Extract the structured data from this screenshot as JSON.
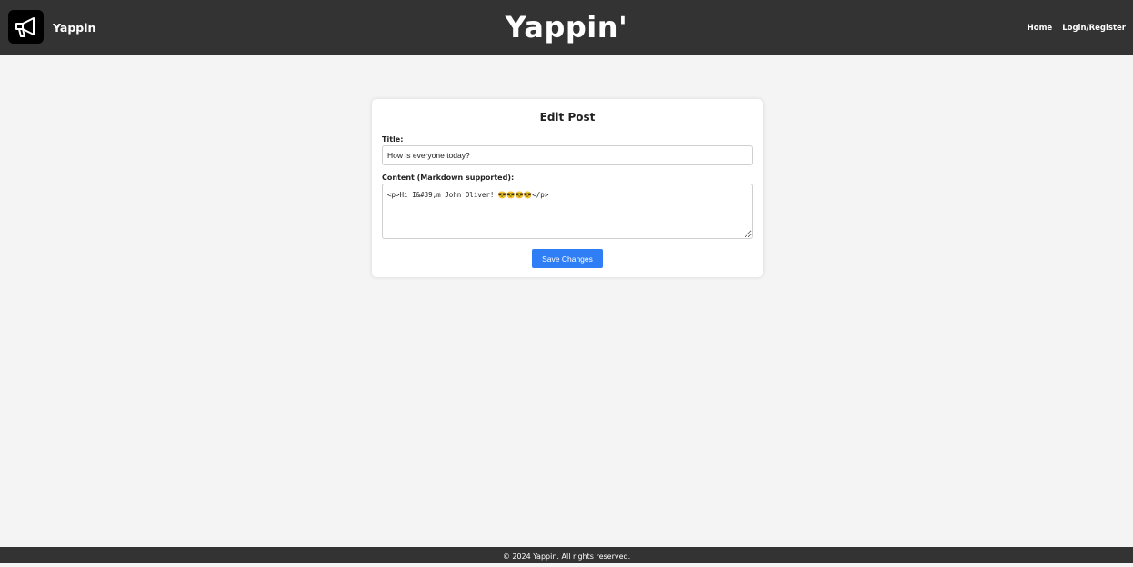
{
  "header": {
    "brand_name": "Yappin",
    "logo_icon": "megaphone-icon",
    "site_title": "Yappin'",
    "nav": {
      "home_label": "Home",
      "login_label": "Login/Register"
    }
  },
  "form": {
    "heading": "Edit Post",
    "title_label": "Title:",
    "title_value": "How is everyone today?",
    "content_label": "Content (Markdown supported):",
    "content_value": "<p>Hi I&#39;m John Oliver! 😎😎😎😎</p>",
    "submit_label": "Save Changes"
  },
  "footer": {
    "copyright": "© 2024 Yappin. All rights reserved."
  },
  "colors": {
    "header_bg": "#333333",
    "page_bg": "#f4f4f4",
    "button_bg": "#2f7ef5",
    "card_bg": "#ffffff"
  }
}
